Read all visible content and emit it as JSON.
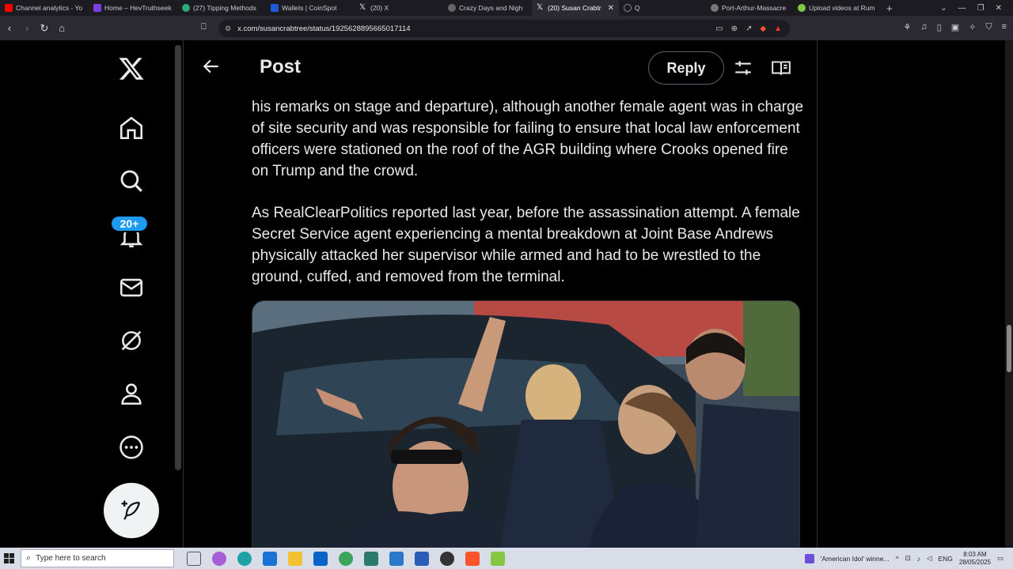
{
  "browser": {
    "tabs": [
      {
        "label": "Channel analytics - Yo",
        "color": "#ff0000"
      },
      {
        "label": "Home – HevTruthseek",
        "color": "#7b3fe4"
      },
      {
        "label": "(27) Tipping Methods",
        "color": "#2aa876"
      },
      {
        "label": "Wallets | CoinSpot",
        "color": "#1f5bd8"
      },
      {
        "label": "(20) X",
        "color": "#333333"
      },
      {
        "label": "Crazy Days and Nigh",
        "color": "#666666"
      },
      {
        "label": "(20) Susan Crabtr",
        "color": "#333333",
        "active": true
      },
      {
        "label": "Q",
        "color": "#444444"
      },
      {
        "label": "Port-Arthur-Massacre",
        "color": "#777777"
      },
      {
        "label": "Upload videos at Rum",
        "color": "#85c742"
      }
    ],
    "url": "x.com/susancrabtree/status/1925628895665017114"
  },
  "header": {
    "title": "Post",
    "reply_label": "Reply"
  },
  "sidebar": {
    "notification_badge": "20+"
  },
  "post": {
    "paragraph1": "his remarks on stage and departure), although another female agent was in charge of site security and was responsible for failing to ensure that local law enforcement officers were stationed on the roof of the AGR building where Crooks opened fire on Trump and the crowd.",
    "paragraph2": "As RealClearPolitics reported last year, before the assassination attempt. A female Secret Service agent experiencing a mental breakdown at Joint Base Andrews physically attacked her supervisor while armed and had to be wrestled to the ground, cuffed, and removed from the terminal."
  },
  "taskbar": {
    "search_placeholder": "Type here to search",
    "news": "'American Idol' winne...",
    "language": "ENG",
    "time": "8:03 AM",
    "date": "28/05/2025"
  }
}
